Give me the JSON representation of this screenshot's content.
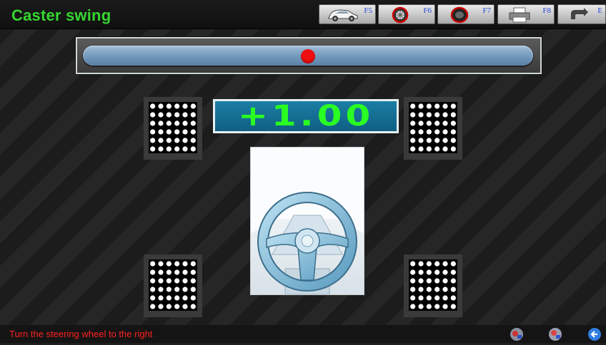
{
  "title": "Caster swing",
  "toolbar": {
    "buttons": [
      {
        "key": "F5",
        "icon": "car-icon"
      },
      {
        "key": "F6",
        "icon": "wheel-icon"
      },
      {
        "key": "F7",
        "icon": "tire-icon"
      },
      {
        "key": "F8",
        "icon": "printer-icon"
      },
      {
        "key": "E",
        "icon": "back-icon"
      }
    ]
  },
  "swing": {
    "position": 0.5,
    "indicator_color": "#ee1010"
  },
  "reading": {
    "value": "+1.00",
    "color": "#2aff22"
  },
  "status": {
    "hint": "Turn the steering wheel to the right",
    "hint_color": "#ff2020"
  },
  "bottom_icons": [
    "wheel-settings-icon",
    "target-settings-icon",
    "return-icon"
  ],
  "colors": {
    "title": "#35d62f",
    "fkey_label": "#2346d8"
  }
}
